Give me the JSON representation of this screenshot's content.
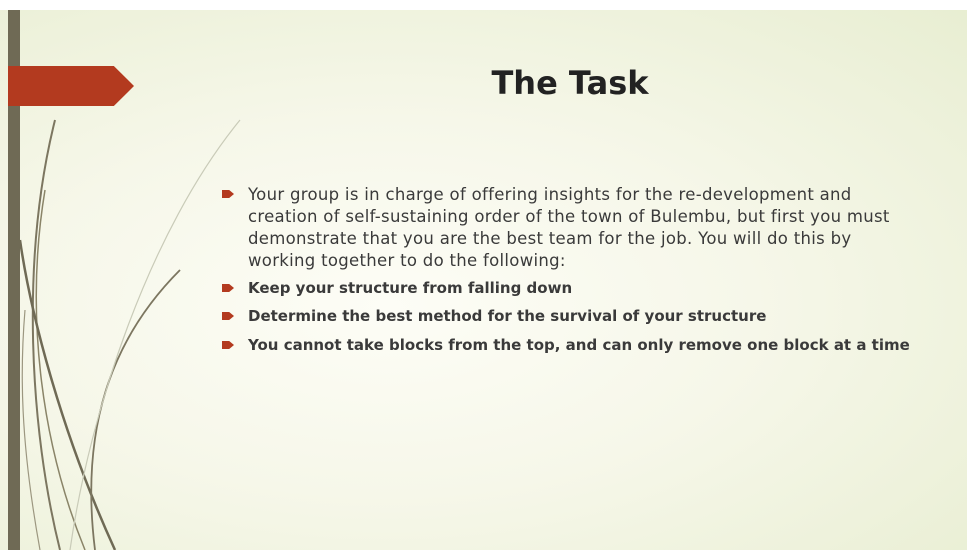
{
  "slide": {
    "title": "The Task",
    "bullets": [
      "Your group is in charge of offering insights for the re-development and creation of self-sustaining order of the town of Bulembu, but first you must demonstrate that you are the best team for the job.  You will do this by working together to do the following:",
      "Keep your structure from falling down",
      "Determine the best method for the survival of your structure",
      "You cannot take blocks from the top, and can only remove one block at a time"
    ]
  },
  "colors": {
    "accent": "#b33a1f",
    "bar": "#6f6a55",
    "background": "#f6f7e9"
  },
  "icons": {
    "bullet": "arrow-bullet-icon",
    "decor": "arrow-tab-icon"
  }
}
